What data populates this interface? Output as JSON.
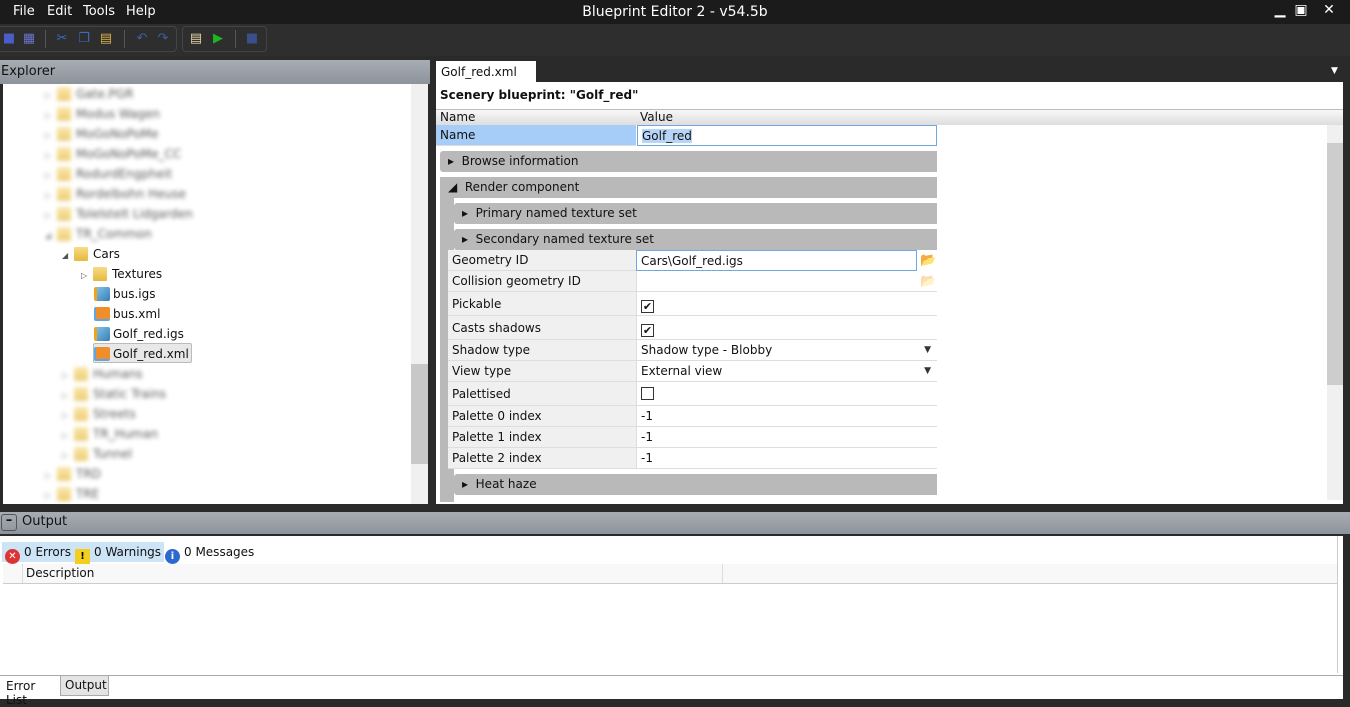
{
  "menu": [
    "File",
    "Edit",
    "Tools",
    "Help"
  ],
  "title": "Blueprint Editor 2 - v54.5b",
  "explorer": {
    "title": "Explorer",
    "blurred_top": [
      "Gate.PGR",
      "Modus Wagen",
      "MoGoNoPoMe",
      "MoGoNoPoMe_CC",
      "RodurdEngpheit",
      "Rordelbohn Heuse",
      "Tolelstelt Lidgarden",
      "TR_Common"
    ],
    "cars": "Cars",
    "textures": "Textures",
    "files": [
      "bus.igs",
      "bus.xml",
      "Golf_red.igs",
      "Golf_red.xml"
    ],
    "blurred_sub": [
      "Humans",
      "Static Trains",
      "Streets",
      "TR_Human",
      "Tunnel"
    ],
    "blurred_bottom": [
      "TRD",
      "TRE"
    ]
  },
  "doc": {
    "tab": "Golf_red.xml",
    "close": "✕",
    "title": "Scenery blueprint: \"Golf_red\"",
    "col_name": "Name",
    "col_value": "Value",
    "name_label": "Name",
    "name_value": "Golf_red",
    "browse": "Browse information",
    "render": "Render component",
    "primary": "Primary named texture set",
    "secondary": "Secondary named texture set",
    "geometry_label": "Geometry ID",
    "geometry_value": "Cars\\Golf_red.igs",
    "collision_label": "Collision geometry ID",
    "pickable": "Pickable",
    "casts": "Casts shadows",
    "shadow_label": "Shadow type",
    "shadow_value": "Shadow type - Blobby",
    "view_label": "View type",
    "view_value": "External view",
    "palettised": "Palettised",
    "p0": "Palette 0 index",
    "p1": "Palette 1 index",
    "p2": "Palette 2 index",
    "pval": "-1",
    "heat": "Heat haze"
  },
  "output": {
    "title": "Output",
    "errors": "0 Errors",
    "warnings": "0 Warnings",
    "messages": "0 Messages",
    "description": "Description",
    "tab_errors": "Error List",
    "tab_output": "Output"
  }
}
